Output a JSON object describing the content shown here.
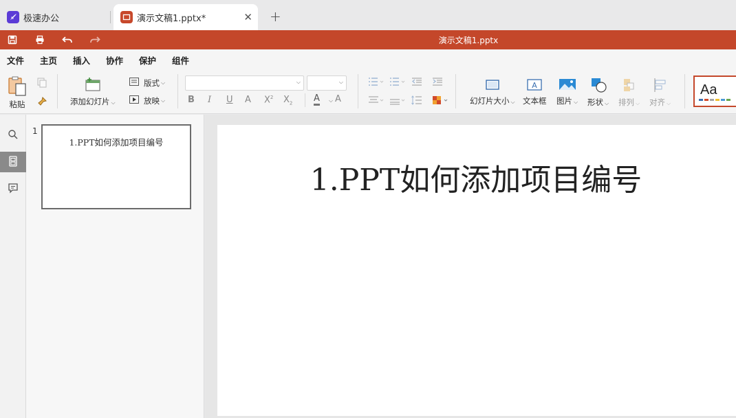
{
  "tabs": {
    "home_label": "极速办公",
    "doc_label": "演示文稿1.pptx*",
    "new_tab": "+",
    "close": "✕"
  },
  "title_bar": {
    "document_title": "演示文稿1.pptx",
    "accent_color": "#c4472a"
  },
  "menu": {
    "items": [
      "文件",
      "主页",
      "插入",
      "协作",
      "保护",
      "组件"
    ],
    "active": "主页"
  },
  "ribbon": {
    "paste": "粘贴",
    "add_slide": "添加幻灯片",
    "layout": "版式",
    "play": "放映",
    "font_name": "",
    "font_size": "",
    "slide_size": "幻灯片大小",
    "text_box": "文本框",
    "picture": "图片",
    "shape": "形状",
    "arrange": "排列",
    "align": "对齐",
    "theme_sample": "Aa"
  },
  "thumbnails": [
    {
      "number": "1",
      "title": "1.PPT如何添加项目编号"
    }
  ],
  "slide": {
    "title": "1.PPT如何添加项目编号"
  }
}
